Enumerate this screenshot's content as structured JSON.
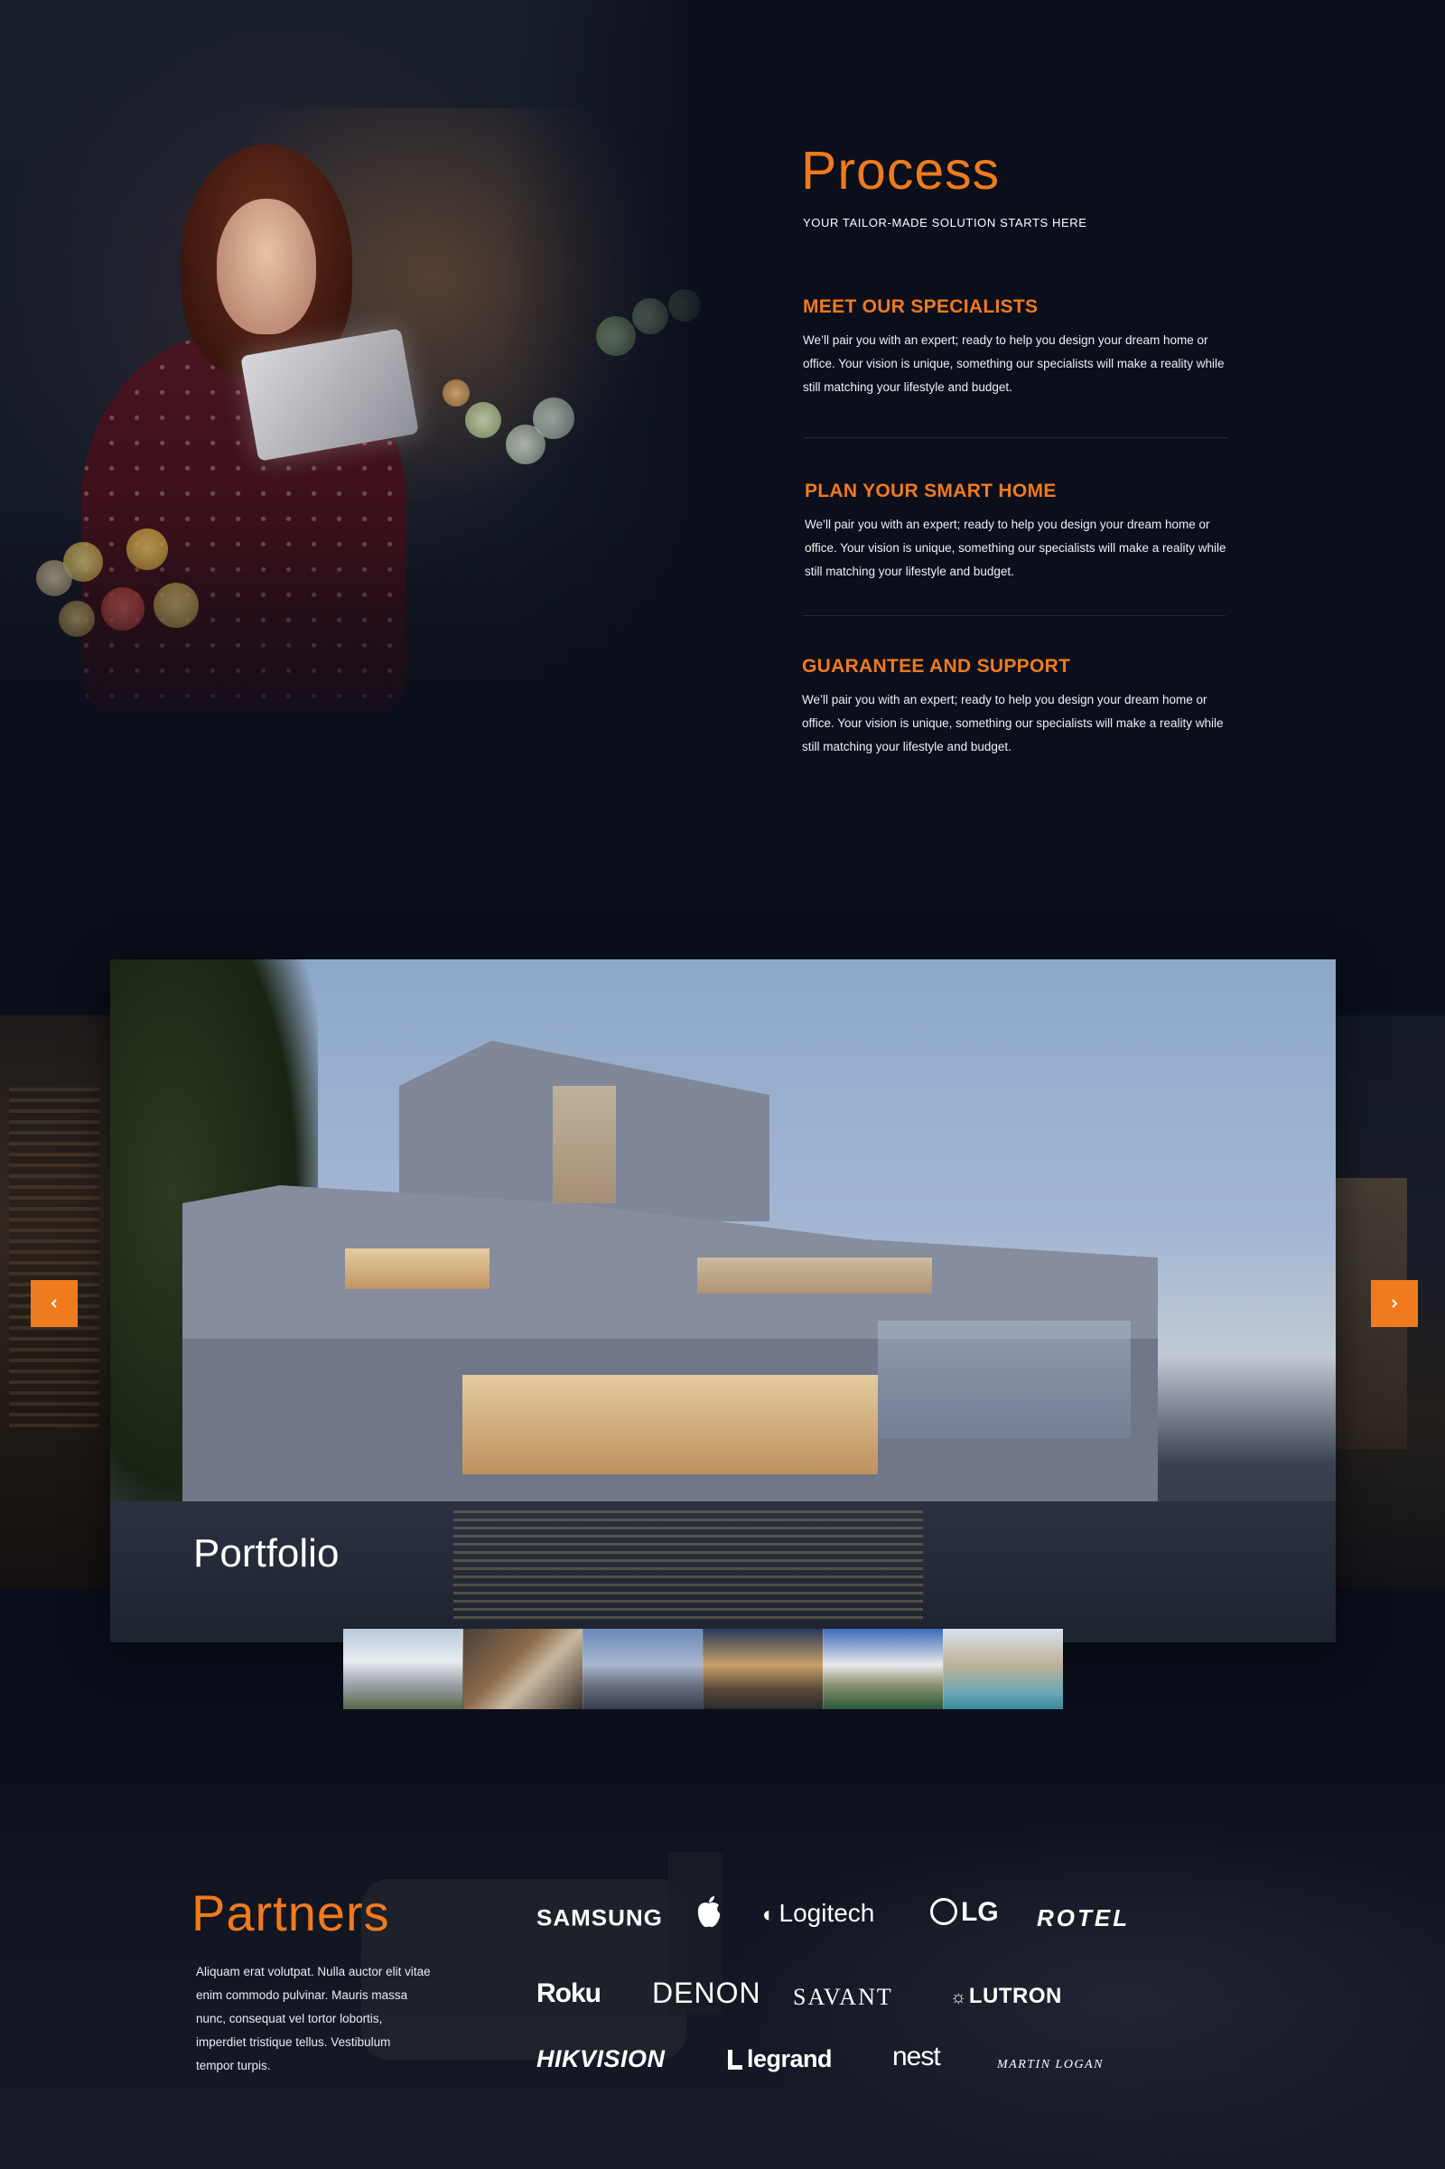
{
  "process": {
    "title": "Process",
    "subtitle": "YOUR TAILOR-MADE SOLUTION STARTS HERE",
    "steps": [
      {
        "heading": "MEET OUR SPECIALISTS",
        "text": "We’ll pair you with an expert; ready to help you design your dream home or office. Your vision is unique, something our specialists will make a reality while still matching your lifestyle and budget."
      },
      {
        "heading": "PLAN YOUR SMART HOME",
        "text": "We’ll pair you with an expert; ready to help you design your dream home or office. Your vision is unique, something our specialists will make a reality while still matching your lifestyle and budget."
      },
      {
        "heading": "GUARANTEE AND SUPPORT",
        "text": "We’ll pair you with an expert; ready to help you design your dream home or office. Your vision is unique, something our specialists will make a reality while still matching your lifestyle and budget."
      }
    ]
  },
  "portfolio": {
    "title": "Portfolio",
    "prev_icon": "chevron-left-icon",
    "next_icon": "chevron-right-icon",
    "thumbnails_count": 6
  },
  "partners": {
    "title": "Partners",
    "text": "Aliquam erat volutpat. Nulla auctor elit vitae enim commodo pulvinar. Mauris massa nunc, consequat vel tortor lobortis, imperdiet tristique tellus. Vestibulum tempor turpis.",
    "logos": [
      "SAMSUNG",
      "Logitech",
      "LG",
      "ROTEL",
      "Roku",
      "DENON",
      "SAVANT",
      "LUTRON",
      "HIKVISION",
      "legrand",
      "nest",
      "MARTIN LOGAN"
    ]
  },
  "colors": {
    "accent": "#f07a1e",
    "background": "#0b0f1b"
  }
}
